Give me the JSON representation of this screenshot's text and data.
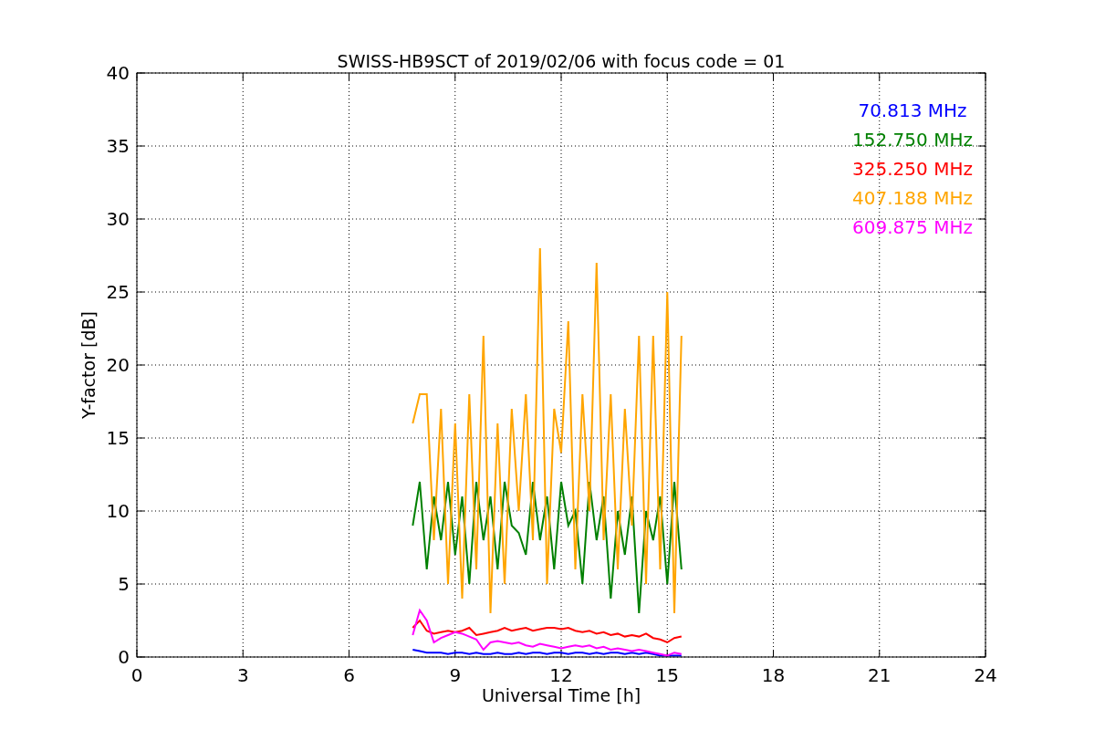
{
  "chart_data": {
    "type": "line",
    "title": "SWISS-HB9SCT of 2019/02/06 with focus code = 01",
    "xlabel": "Universal Time [h]",
    "ylabel": "Y-factor [dB]",
    "x": [
      7.8,
      8.0,
      8.2,
      8.4,
      8.6,
      8.8,
      9.0,
      9.2,
      9.4,
      9.6,
      9.8,
      10.0,
      10.2,
      10.4,
      10.6,
      10.8,
      11.0,
      11.2,
      11.4,
      11.6,
      11.8,
      12.0,
      12.2,
      12.4,
      12.6,
      12.8,
      13.0,
      13.2,
      13.4,
      13.6,
      13.8,
      14.0,
      14.2,
      14.4,
      14.6,
      14.8,
      15.0,
      15.2,
      15.4
    ],
    "series": [
      {
        "name": "70.813 MHz",
        "color": "#0000ff",
        "values": [
          0.5,
          0.4,
          0.3,
          0.3,
          0.3,
          0.2,
          0.3,
          0.3,
          0.2,
          0.3,
          0.2,
          0.2,
          0.3,
          0.2,
          0.2,
          0.3,
          0.2,
          0.3,
          0.3,
          0.2,
          0.3,
          0.3,
          0.2,
          0.3,
          0.3,
          0.2,
          0.3,
          0.2,
          0.3,
          0.3,
          0.2,
          0.3,
          0.2,
          0.3,
          0.2,
          0.1,
          0.1,
          0.1,
          0.1
        ]
      },
      {
        "name": "152.750 MHz",
        "color": "#008000",
        "values": [
          9,
          12,
          6,
          11,
          8,
          12,
          7,
          11,
          5,
          12,
          8,
          11,
          6,
          12,
          9,
          8.5,
          7,
          12,
          8,
          11,
          6,
          12,
          9,
          10,
          5,
          12,
          8,
          11,
          4,
          10,
          7,
          11,
          3,
          10,
          8,
          11,
          5,
          12,
          6
        ]
      },
      {
        "name": "325.250 MHz",
        "color": "#ff0000",
        "values": [
          2,
          2.5,
          1.8,
          1.6,
          1.7,
          1.8,
          1.7,
          1.8,
          2,
          1.5,
          1.6,
          1.7,
          1.8,
          2,
          1.8,
          1.9,
          2,
          1.8,
          1.9,
          2,
          2,
          1.9,
          2,
          1.8,
          1.7,
          1.8,
          1.6,
          1.7,
          1.5,
          1.6,
          1.4,
          1.5,
          1.4,
          1.6,
          1.3,
          1.2,
          1.0,
          1.3,
          1.4
        ]
      },
      {
        "name": "407.188 MHz",
        "color": "#ffa500",
        "values": [
          16,
          18,
          18,
          8,
          17,
          5,
          16,
          4,
          18,
          6,
          22,
          3,
          16,
          5,
          17,
          10,
          18,
          8,
          28,
          5,
          17,
          14,
          23,
          6,
          18,
          10,
          27,
          8,
          18,
          6,
          17,
          9,
          22,
          5,
          22,
          6,
          25,
          3,
          22
        ]
      },
      {
        "name": "609.875 MHz",
        "color": "#ff00ff",
        "values": [
          1.5,
          3.2,
          2.5,
          1.0,
          1.3,
          1.5,
          1.7,
          1.6,
          1.4,
          1.2,
          0.5,
          1.0,
          1.1,
          1.0,
          0.9,
          1.0,
          0.8,
          0.7,
          0.9,
          0.8,
          0.7,
          0.6,
          0.7,
          0.8,
          0.7,
          0.8,
          0.6,
          0.7,
          0.5,
          0.6,
          0.5,
          0.4,
          0.5,
          0.4,
          0.3,
          0.2,
          0.1,
          0.3,
          0.2
        ]
      }
    ],
    "xlim": [
      0,
      24
    ],
    "ylim": [
      0,
      40
    ],
    "xticks": [
      0,
      3,
      6,
      9,
      12,
      15,
      18,
      21,
      24
    ],
    "yticks": [
      0,
      5,
      10,
      15,
      20,
      25,
      30,
      35,
      40
    ],
    "grid": true
  }
}
